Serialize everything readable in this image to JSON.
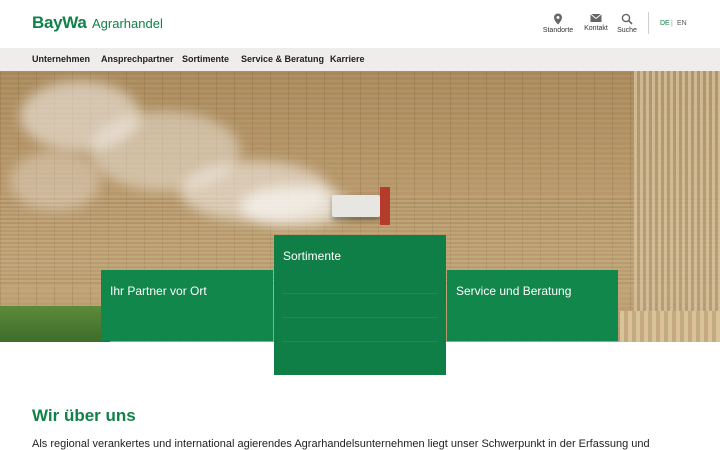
{
  "header": {
    "logo": "BayWa",
    "brand_sub": "Agrarhandel",
    "utilities": [
      {
        "label": "Standorte",
        "icon": "location-pin-icon"
      },
      {
        "label": "Kontakt",
        "icon": "envelope-icon"
      },
      {
        "label": "Suche",
        "icon": "search-icon"
      }
    ],
    "languages": {
      "active": "DE",
      "separator": "|",
      "other": "EN"
    }
  },
  "nav": {
    "items": [
      {
        "label": "Unternehmen"
      },
      {
        "label": "Ansprechpartner"
      },
      {
        "label": "Sortimente"
      },
      {
        "label": "Service & Beratung"
      },
      {
        "label": "Karriere"
      }
    ]
  },
  "cards": {
    "partner": {
      "title": "Ihr Partner vor Ort"
    },
    "sortimente": {
      "title": "Sortimente"
    },
    "service": {
      "title": "Service und Beratung"
    }
  },
  "content": {
    "title": "Wir über uns",
    "intro": "Als regional verankertes und international agierendes Agrarhandelsunternehmen liegt unser Schwerpunkt in der Erfassung und"
  },
  "colors": {
    "brand_green": "#11804a",
    "card_green": "#11874c",
    "nav_bg": "#efedeb"
  }
}
